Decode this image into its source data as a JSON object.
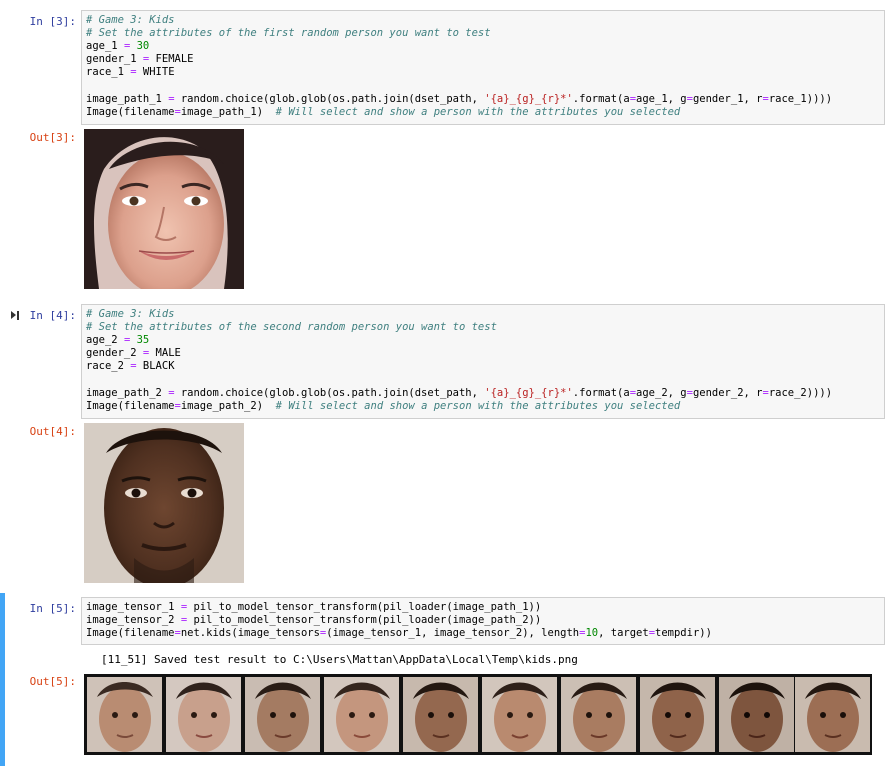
{
  "cells": [
    {
      "in_prompt": "In [3]:",
      "out_prompt": "Out[3]:",
      "code": {
        "line1": "# Game 3: Kids",
        "line2": "# Set the attributes of the first random person you want to test",
        "l3_a": "age_1 ",
        "l3_op": "=",
        "l3_num": " 30",
        "l4_a": "gender_1 ",
        "l4_op": "=",
        "l4_b": " FEMALE",
        "l5_a": "race_1 ",
        "l5_op": "=",
        "l5_b": " WHITE",
        "l7_a": "image_path_1 ",
        "l7_op": "=",
        "l7_b": " random.choice(glob.glob(os.path.join(dset_path, ",
        "l7_str": "'{a}_{g}_{r}*'",
        "l7_c": ".format(a",
        "l7_op2": "=",
        "l7_d": "age_1, g",
        "l7_op3": "=",
        "l7_e": "gender_1, r",
        "l7_op4": "=",
        "l7_f": "race_1))))",
        "l8_a": "Image(filename",
        "l8_op": "=",
        "l8_b": "image_path_1)  ",
        "l8_cm": "# Will select and show a person with the attributes you selected"
      }
    },
    {
      "in_prompt": "In [4]:",
      "out_prompt": "Out[4]:",
      "code": {
        "line1": "# Game 3: Kids",
        "line2": "# Set the attributes of the second random person you want to test",
        "l3_a": "age_2 ",
        "l3_op": "=",
        "l3_num": " 35",
        "l4_a": "gender_2 ",
        "l4_op": "=",
        "l4_b": " MALE",
        "l5_a": "race_2 ",
        "l5_op": "=",
        "l5_b": " BLACK",
        "l7_a": "image_path_2 ",
        "l7_op": "=",
        "l7_b": " random.choice(glob.glob(os.path.join(dset_path, ",
        "l7_str": "'{a}_{g}_{r}*'",
        "l7_c": ".format(a",
        "l7_op2": "=",
        "l7_d": "age_2, g",
        "l7_op3": "=",
        "l7_e": "gender_2, r",
        "l7_op4": "=",
        "l7_f": "race_2))))",
        "l8_a": "Image(filename",
        "l8_op": "=",
        "l8_b": "image_path_2)  ",
        "l8_cm": "# Will select and show a person with the attributes you selected"
      }
    },
    {
      "in_prompt": "In [5]:",
      "out_prompt": "Out[5]:",
      "code": {
        "l1_a": "image_tensor_1 ",
        "l1_op": "=",
        "l1_b": " pil_to_model_tensor_transform(pil_loader(image_path_1))",
        "l2_a": "image_tensor_2 ",
        "l2_op": "=",
        "l2_b": " pil_to_model_tensor_transform(pil_loader(image_path_2))",
        "l3_a": "Image(filename",
        "l3_op": "=",
        "l3_b": "net.kids(image_tensors",
        "l3_op2": "=",
        "l3_c": "(image_tensor_1, image_tensor_2), length",
        "l3_op3": "=",
        "l3_num": "10",
        "l3_d": ", target",
        "l3_op4": "=",
        "l3_e": "tempdir))"
      },
      "stdout": "[11_51] Saved test result to C:\\Users\\Mattan\\AppData\\Local\\Temp\\kids.png"
    }
  ],
  "colors": {
    "prompt_in": "#303f9f",
    "prompt_out": "#d84315",
    "selected_border": "#42a5f5",
    "code_bg": "#f7f7f7"
  }
}
